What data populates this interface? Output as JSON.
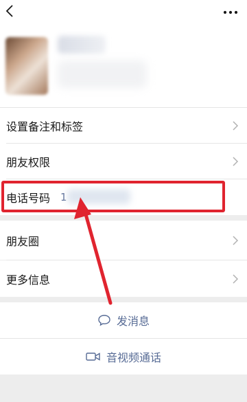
{
  "rows": {
    "remark": {
      "label": "设置备注和标签"
    },
    "permission": {
      "label": "朋友权限"
    },
    "phone": {
      "label": "电话号码",
      "value": "1"
    },
    "moments": {
      "label": "朋友圈"
    },
    "more_info": {
      "label": "更多信息"
    }
  },
  "actions": {
    "message": {
      "label": "发消息",
      "icon": "chat-bubble-icon"
    },
    "av_call": {
      "label": "音视频通话",
      "icon": "video-camera-icon"
    }
  },
  "header": {
    "back_icon": "back-chevron-icon",
    "more_icon": "more-dots-icon"
  },
  "annotation": {
    "highlight_color": "#e0242f"
  }
}
